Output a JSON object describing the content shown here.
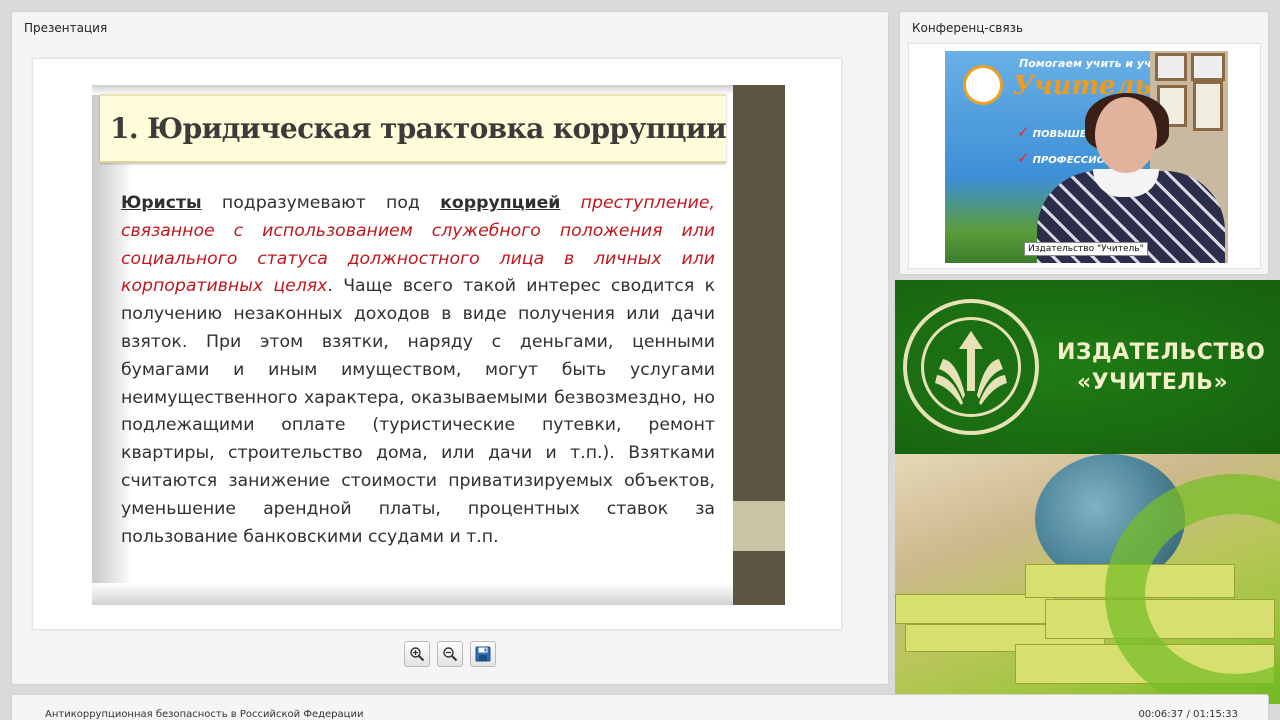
{
  "presentation": {
    "panel_title": "Презентация",
    "slide": {
      "title": "1. Юридическая трактовка коррупции",
      "body": {
        "w1": "Юристы",
        "t1": " подразумевают под ",
        "w2": "коррупцией",
        "t2": " ",
        "red": "преступление, связанное с использованием служебного положения или социального статуса должностного лица в личных или корпоративных целях",
        "rest": ". Чаще всего такой интерес сводится к получению незаконных доходов в виде получения или дачи взяток. При этом взятки, наряду с деньгами, ценными бумагами и иным имуществом, могут быть услугами неимущественного характера, оказываемыми безвозмездно, но подлежащими оплате (туристические путевки, ремонт квартиры, строительство дома, или дачи и т.п.). Взятками считаются занижение стоимости приватизируемых объектов, уменьшение арендной платы, процентных ставок за пользование банковскими ссудами и т.п."
      }
    },
    "toolbar": {
      "zoom_in_icon": "zoom-in-icon",
      "zoom_out_icon": "zoom-out-icon",
      "save_icon": "save-icon"
    }
  },
  "conference": {
    "panel_title": "Конференц-связь",
    "video_caption": "Издательство \"Учитель\"",
    "poster": {
      "line1": "Помогаем учить и учиться",
      "brand": "Учитель",
      "items": [
        "ПОВЫШЕНИЕ КВАЛИФИ...",
        "ПРОФЕССИОН... ПЕРЕПО..."
      ]
    }
  },
  "banner": {
    "name_line1": "ИЗДАТЕЛЬСТВО",
    "name_line2": "«УЧИТЕЛЬ»"
  },
  "status_bar": {
    "title": "Антикоррупционная безопасность в Российской Федерации",
    "time": "00:06:37 / 01:15:33"
  },
  "colors": {
    "slide_side_bar": "#5e5444",
    "slide_title_bg": "#fffdd9",
    "slide_highlight_red": "#c0171e",
    "banner_green": "#1c7a12",
    "banner_text": "#f2efc9"
  }
}
